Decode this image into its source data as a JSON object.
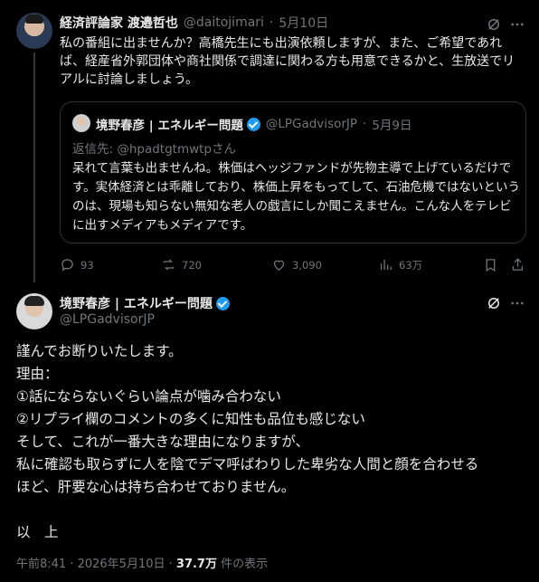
{
  "reply_post": {
    "author": "経済評論家 渡邉哲也",
    "handle": "@daitojimari",
    "dot": "·",
    "date": "5月10日",
    "text": "私の番組に出ませんか？高橋先生にも出演依頼しますが、また、ご希望であれば、経産省外郭団体や商社関係で調達に関わる方も用意できるかと、生放送でリアルに討論しましょう。",
    "quote": {
      "author": "境野春彦 | エネルギー問題",
      "handle": "@LPGadvisorJP",
      "dot": "·",
      "date": "5月9日",
      "reply_to": "返信先: @hpadtgtmwtpさん",
      "text": "呆れて言葉も出ませんね。株価はヘッジファンドが先物主導で上げているだけです。実体経済とは乖離しており、株価上昇をもってして、石油危機ではないというのは、現場も知らない無知な老人の戯言にしか聞こえません。こんな人をテレビに出すメディアもメディアです。"
    },
    "actions": {
      "replies": "93",
      "reposts": "720",
      "likes": "3,090",
      "views": "63万"
    }
  },
  "main_post": {
    "author": "境野春彦 | エネルギー問題",
    "handle": "@LPGadvisorJP",
    "lines": [
      "謹んでお断りいたします。",
      "理由：",
      "①話にならないぐらい論点が噛み合わない",
      "②リプライ欄のコメントの多くに知性も品位も感じない",
      "そして、これが一番大きな理由になりますが、",
      "私に確認も取らずに人を陰でデマ呼ばわりした卑劣な人間と顔を合わせる",
      "ほど、肝要な心は持ち合わせておりません。",
      "",
      "以　上"
    ],
    "time": "午前8:41 · 2026年5月10日 ·",
    "views_count": "37.7万",
    "views_label": "件の表示"
  },
  "colors": {
    "background": "#000000",
    "text": "#e7e9ea",
    "muted": "#71767b",
    "border": "#2f3336",
    "verified": "#1d9bf0"
  }
}
